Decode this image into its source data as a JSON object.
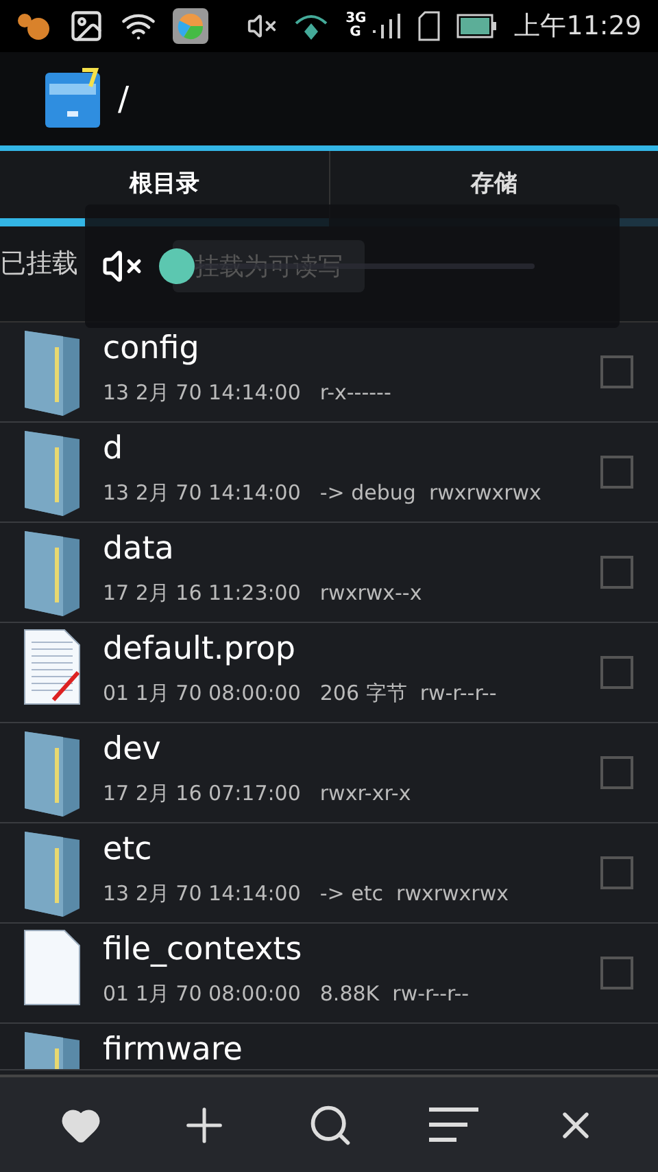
{
  "status_bar": {
    "network": "3G",
    "network_sub": "G",
    "time": "上午11:29"
  },
  "app_bar": {
    "path": "/"
  },
  "tabs": [
    {
      "label": "根目录",
      "selected": true
    },
    {
      "label": "存储",
      "selected": false
    }
  ],
  "mount_bar": {
    "status": "已挂载",
    "button": "挂载为可读写"
  },
  "volume_popup": {
    "muted": true,
    "level": 0
  },
  "files": [
    {
      "kind": "folder",
      "name": "config",
      "date": "13 2月 70 14:14:00",
      "info": "r-x------",
      "checked": false
    },
    {
      "kind": "folder",
      "name": "d",
      "date": "13 2月 70 14:14:00",
      "info": "-> debug  rwxrwxrwx",
      "checked": false
    },
    {
      "kind": "folder",
      "name": "data",
      "date": "17 2月 16 11:23:00",
      "info": "rwxrwx--x",
      "checked": false
    },
    {
      "kind": "text-file",
      "name": "default.prop",
      "date": "01 1月 70 08:00:00",
      "info": "206 字节  rw-r--r--",
      "checked": false
    },
    {
      "kind": "folder",
      "name": "dev",
      "date": "17 2月 16 07:17:00",
      "info": "rwxr-xr-x",
      "checked": false
    },
    {
      "kind": "folder",
      "name": "etc",
      "date": "13 2月 70 14:14:00",
      "info": "-> etc  rwxrwxrwx",
      "checked": false
    },
    {
      "kind": "file",
      "name": "file_contexts",
      "date": "01 1月 70 08:00:00",
      "info": "8.88K  rw-r--r--",
      "checked": false
    },
    {
      "kind": "folder",
      "name": "firmware"
    }
  ]
}
